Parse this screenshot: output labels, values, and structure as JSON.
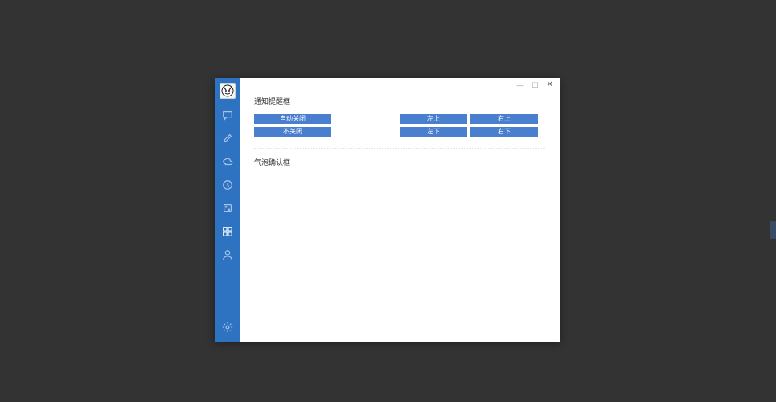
{
  "sidebar": {
    "nav": [
      {
        "name": "chat"
      },
      {
        "name": "brush"
      },
      {
        "name": "cloud"
      },
      {
        "name": "clock"
      },
      {
        "name": "dice"
      },
      {
        "name": "apps",
        "active": true
      },
      {
        "name": "user"
      }
    ],
    "settings": {
      "name": "gear"
    }
  },
  "window_controls": {
    "minimize": "—",
    "maximize": "☐",
    "close": "✕"
  },
  "sections": {
    "notify": {
      "title": "通知提醒框",
      "left_buttons": [
        "自动关闭",
        "不关闭"
      ],
      "right_buttons": [
        "左上",
        "右上",
        "左下",
        "右下"
      ]
    },
    "confirm": {
      "title": "气泡确认框"
    }
  }
}
